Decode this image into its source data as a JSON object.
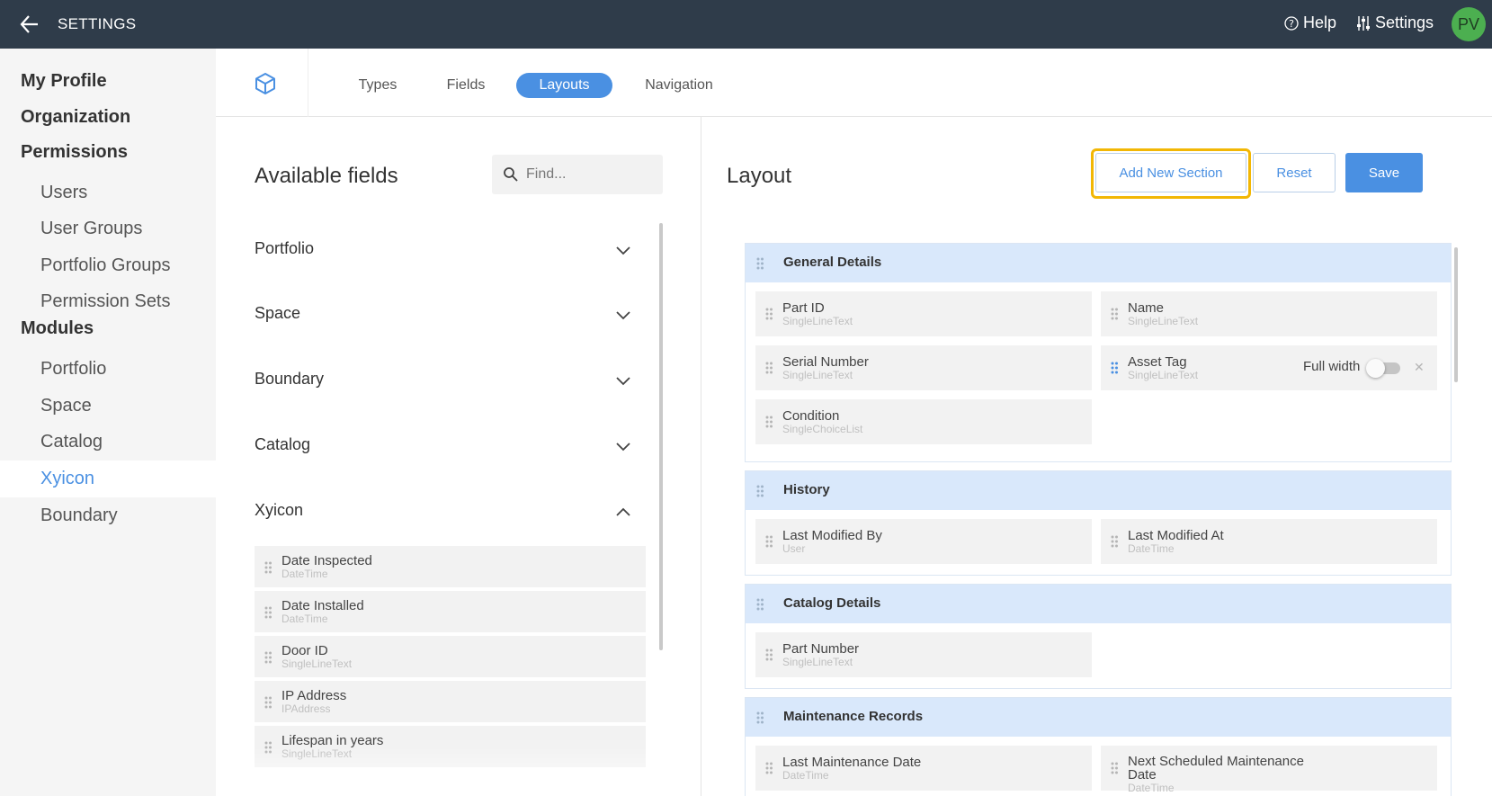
{
  "header": {
    "title": "SETTINGS",
    "help_label": "Help",
    "settings_label": "Settings",
    "avatar_initials": "PV"
  },
  "sidebar": {
    "sections": [
      {
        "label": "My Profile"
      },
      {
        "label": "Organization"
      },
      {
        "label": "Permissions"
      },
      {
        "label": "Modules"
      }
    ],
    "permission_items": [
      {
        "label": "Users"
      },
      {
        "label": "User Groups"
      },
      {
        "label": "Portfolio Groups"
      },
      {
        "label": "Permission Sets"
      }
    ],
    "module_items": [
      {
        "label": "Portfolio"
      },
      {
        "label": "Space"
      },
      {
        "label": "Catalog"
      },
      {
        "label": "Xyicon",
        "active": true
      },
      {
        "label": "Boundary"
      }
    ]
  },
  "subnav": {
    "icon": "cube-icon",
    "tabs": [
      {
        "label": "Types"
      },
      {
        "label": "Fields"
      },
      {
        "label": "Layouts",
        "active": true
      },
      {
        "label": "Navigation"
      }
    ]
  },
  "available": {
    "title": "Available fields",
    "search_placeholder": "Find...",
    "groups": [
      {
        "label": "Portfolio",
        "expanded": false
      },
      {
        "label": "Space",
        "expanded": false
      },
      {
        "label": "Boundary",
        "expanded": false
      },
      {
        "label": "Catalog",
        "expanded": false
      },
      {
        "label": "Xyicon",
        "expanded": true
      }
    ],
    "fields": [
      {
        "name": "Date Inspected",
        "type": "DateTime"
      },
      {
        "name": "Date Installed",
        "type": "DateTime"
      },
      {
        "name": "Door ID",
        "type": "SingleLineText"
      },
      {
        "name": "IP Address",
        "type": "IPAddress"
      },
      {
        "name": "Lifespan in years",
        "type": "SingleLineText"
      }
    ]
  },
  "layout": {
    "title": "Layout",
    "add_section_label": "Add New Section",
    "reset_label": "Reset",
    "save_label": "Save",
    "full_width_label": "Full width",
    "full_width_on": false,
    "sections": [
      {
        "title": "General Details",
        "fields": [
          {
            "name": "Part ID",
            "type": "SingleLineText"
          },
          {
            "name": "Name",
            "type": "SingleLineText"
          },
          {
            "name": "Serial Number",
            "type": "SingleLineText"
          },
          {
            "name": "Asset Tag",
            "type": "SingleLineText"
          },
          {
            "name": "Condition",
            "type": "SingleChoiceList"
          }
        ]
      },
      {
        "title": "History",
        "fields": [
          {
            "name": "Last Modified By",
            "type": "User"
          },
          {
            "name": "Last Modified At",
            "type": "DateTime"
          }
        ]
      },
      {
        "title": "Catalog Details",
        "fields": [
          {
            "name": "Part Number",
            "type": "SingleLineText"
          }
        ]
      },
      {
        "title": "Maintenance Records",
        "fields": [
          {
            "name": "Last Maintenance Date",
            "type": "DateTime"
          },
          {
            "name": "Next Scheduled Maintenance Date",
            "type": "DateTime"
          }
        ]
      }
    ]
  },
  "colors": {
    "topbar": "#2f3c4a",
    "accent": "#4a90e2",
    "section_header": "#d9e8fb",
    "highlight": "#f2b705",
    "avatar": "#4caf50"
  }
}
